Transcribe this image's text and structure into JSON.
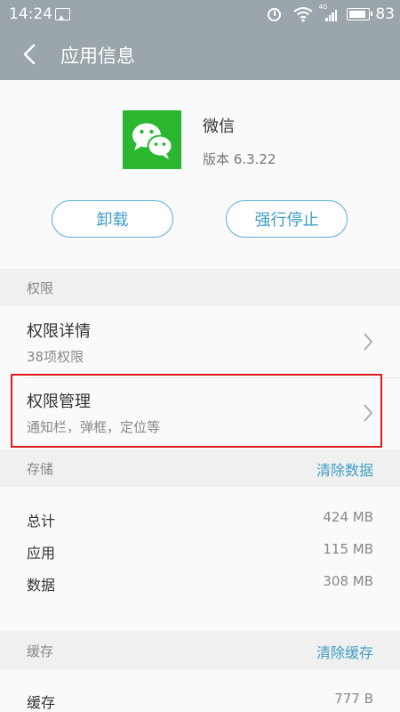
{
  "status_bar": {
    "time": "14:24",
    "battery": "83",
    "network_tag": "4G"
  },
  "header": {
    "title": "应用信息"
  },
  "app": {
    "name": "微信",
    "version": "版本 6.3.22",
    "brand_color": "#2bb730"
  },
  "buttons": {
    "uninstall": "卸载",
    "force_stop": "强行停止"
  },
  "permissions": {
    "section_label": "权限",
    "items": [
      {
        "title": "权限详情",
        "subtitle": "38项权限"
      },
      {
        "title": "权限管理",
        "subtitle": "通知栏，弹框，定位等"
      }
    ]
  },
  "storage": {
    "section_label": "存储",
    "action": "清除数据",
    "rows": [
      {
        "label": "总计",
        "value": "424 MB"
      },
      {
        "label": "应用",
        "value": "115 MB"
      },
      {
        "label": "数据",
        "value": "308 MB"
      }
    ]
  },
  "cache": {
    "section_label": "缓存",
    "action": "清除缓存",
    "rows": [
      {
        "label": "缓存",
        "value": "777 B"
      }
    ]
  },
  "colors": {
    "header_bg": "#9aa6ab",
    "accent": "#3f9dc6",
    "highlight": "#e01b1b"
  }
}
